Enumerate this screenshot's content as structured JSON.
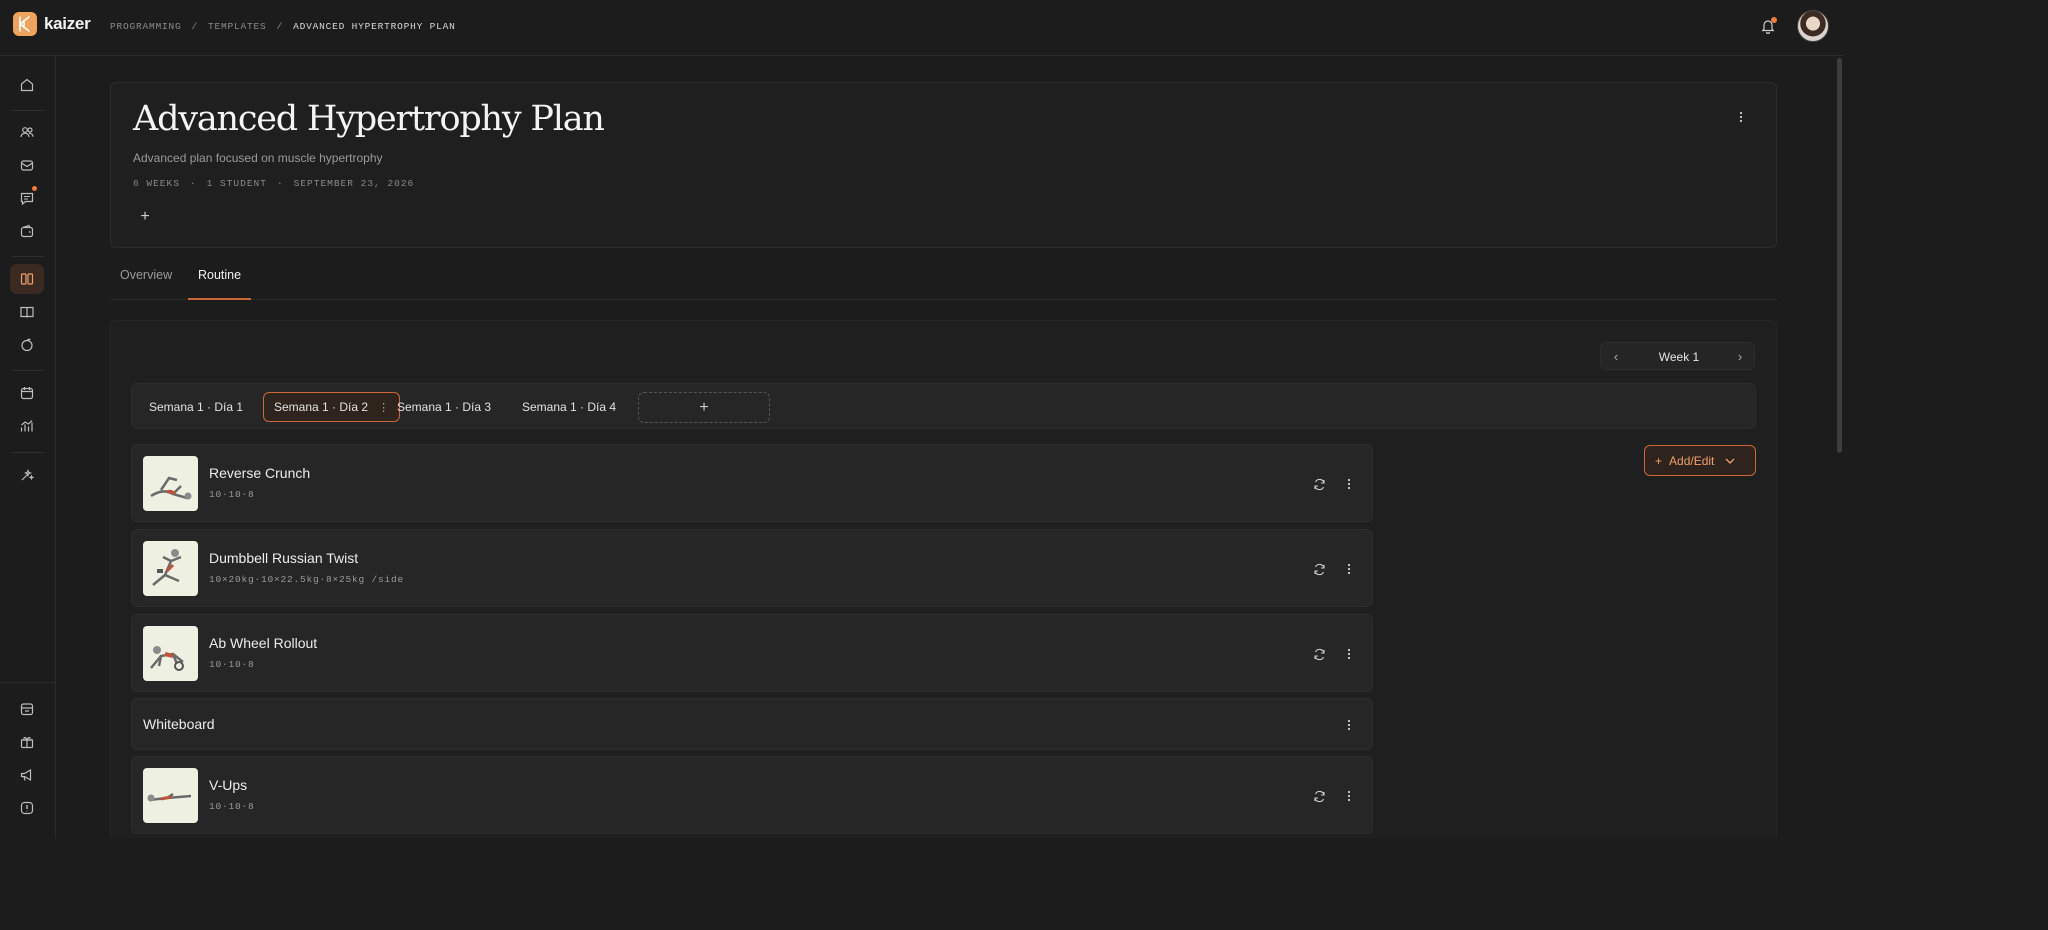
{
  "brand": {
    "name": "kaizer"
  },
  "breadcrumb": [
    "PROGRAMMING",
    "TEMPLATES",
    "ADVANCED HYPERTROPHY PLAN"
  ],
  "breadcrumb_separator": "/",
  "header": {
    "title": "Advanced Hypertrophy Plan",
    "description": "Advanced plan focused on muscle hypertrophy",
    "meta": [
      "6 WEEKS",
      "1 STUDENT",
      "SEPTEMBER 23, 2026"
    ],
    "meta_separator": "·",
    "add_tag_label": "+"
  },
  "tabs": [
    {
      "label": "Overview",
      "active": false
    },
    {
      "label": "Routine",
      "active": true
    }
  ],
  "week_nav": {
    "label": "Week 1",
    "prev": "‹",
    "next": "›"
  },
  "days": [
    {
      "label": "Semana 1 · Día 1",
      "active": false
    },
    {
      "label": "Semana 1 · Día 2",
      "active": true
    },
    {
      "label": "Semana 1 · Día 3",
      "active": false
    },
    {
      "label": "Semana 1 · Día 4",
      "active": false
    }
  ],
  "add_day_label": "+",
  "add_edit": {
    "label": "Add/Edit"
  },
  "exercises": [
    {
      "name": "Reverse Crunch",
      "scheme": "10·10·8"
    },
    {
      "name": "Dumbbell Russian Twist",
      "scheme": "10×20kg·10×22.5kg·8×25kg /side"
    },
    {
      "name": "Ab Wheel Rollout",
      "scheme": "10·10·8"
    },
    {
      "name": "V-Ups",
      "scheme": "10·10·8"
    }
  ],
  "whiteboard": {
    "label": "Whiteboard"
  },
  "colors": {
    "accent": "#c8683a",
    "notification": "#f07c3c",
    "logo": "#f0a35e"
  },
  "icons": {
    "sidebar": [
      "home-icon",
      "users-icon",
      "inbox-icon",
      "chat-icon",
      "wallet-icon",
      "programs-icon",
      "library-icon",
      "nutrition-icon",
      "calendar-icon",
      "analytics-icon",
      "ai-sparkle-icon",
      "store-icon",
      "gift-icon",
      "megaphone-icon",
      "help-icon"
    ]
  }
}
